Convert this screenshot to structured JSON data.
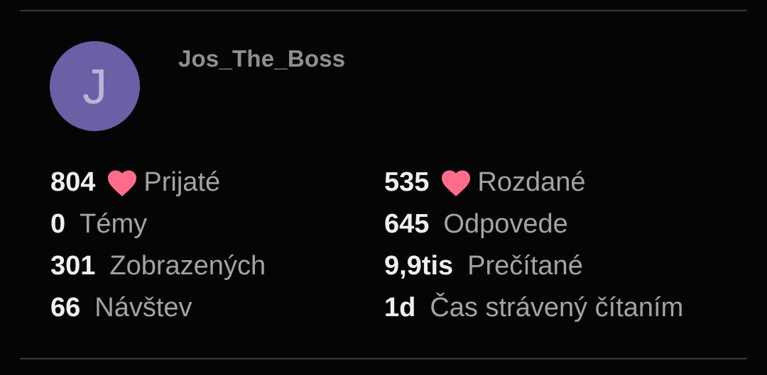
{
  "profile": {
    "avatar_letter": "J",
    "avatar_color": "#6b5fa6",
    "username": "Jos_The_Boss"
  },
  "stats": {
    "likes_received": {
      "value": "804",
      "label": "Prijaté",
      "icon": "heart-icon"
    },
    "likes_given": {
      "value": "535",
      "label": "Rozdané",
      "icon": "heart-icon"
    },
    "topics": {
      "value": "0",
      "label": "Témy"
    },
    "replies": {
      "value": "645",
      "label": "Odpovede"
    },
    "views": {
      "value": "301",
      "label": "Zobrazených"
    },
    "read": {
      "value": "9,9tis",
      "label": "Prečítané"
    },
    "visits": {
      "value": "66",
      "label": "Návštev"
    },
    "read_time": {
      "value": "1d",
      "label": "Čas strávený čítaním"
    }
  },
  "colors": {
    "heart": "#ff6b8a",
    "background": "#050505"
  }
}
